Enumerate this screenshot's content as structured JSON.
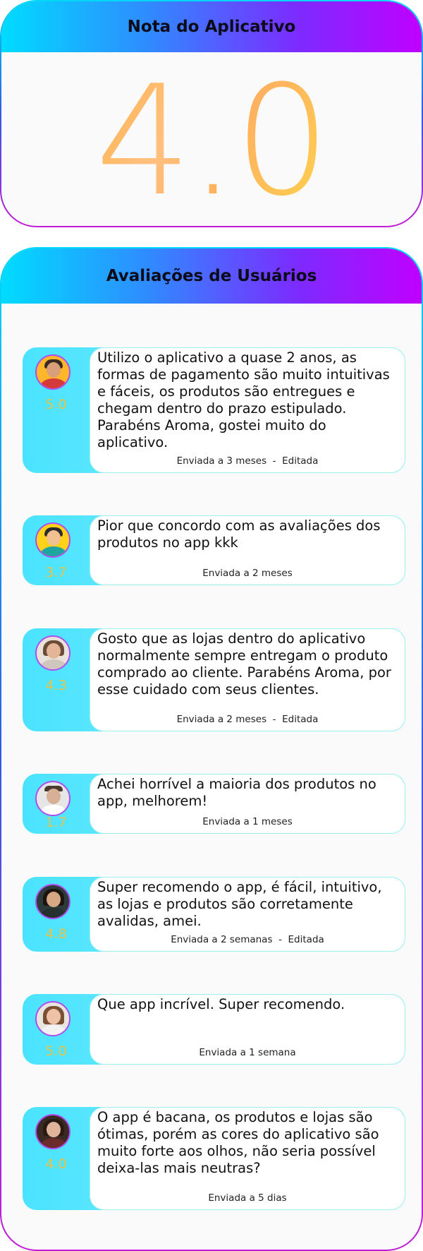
{
  "rating_card": {
    "title": "Nota do Aplicativo",
    "score": "4.0"
  },
  "reviews_card": {
    "title": "Avaliações de Usuários",
    "reviews": [
      {
        "score": "5.0",
        "text": "Utilizo o aplicativo a quase 2 anos, as formas de pagamento são muito intuitivas e fáceis, os produtos são entregues e chegam dentro do prazo estipulado. Parabéns Aroma, gostei muito do aplicativo.",
        "meta": "Enviada a 3 meses  -  Editada",
        "avatar": "man-beard-avatar"
      },
      {
        "score": "3.7",
        "text": "Pior que concordo com as avaliações dos produtos no app kkk",
        "meta": "Enviada a 2 meses",
        "avatar": "man-cartoon-avatar"
      },
      {
        "score": "4.3",
        "text": "Gosto que as lojas dentro do aplicativo normalmente sempre entregam o produto comprado ao cliente. Parabéns Aroma, por esse cuidado com seus clientes.",
        "meta": "Enviada a 2 meses  -  Editada",
        "avatar": "woman-curly-avatar"
      },
      {
        "score": "1.7",
        "text": "Achei horrível a maioria dos produtos no app, melhorem!",
        "meta": "Enviada a 1 meses",
        "avatar": "man-bald-avatar"
      },
      {
        "score": "4.8",
        "text": "Super recomendo o app, é fácil, intuitivo, as lojas e produtos são corretamente avalidas, amei.",
        "meta": "Enviada a 2 semanas  -  Editada",
        "avatar": "woman-dark-hair-avatar"
      },
      {
        "score": "5.0",
        "text": "Que app incrível. Super recomendo.",
        "meta": "Enviada a 1 semana",
        "avatar": "woman-long-hair-avatar"
      },
      {
        "score": "4.0",
        "text": "O app é bacana, os produtos e lojas são ótimas, porém as cores do aplicativo são muito forte aos olhos, não seria possível deixa-las mais neutras?",
        "meta": "Enviada a 5 dias",
        "avatar": "woman-glasses-avatar"
      }
    ]
  }
}
